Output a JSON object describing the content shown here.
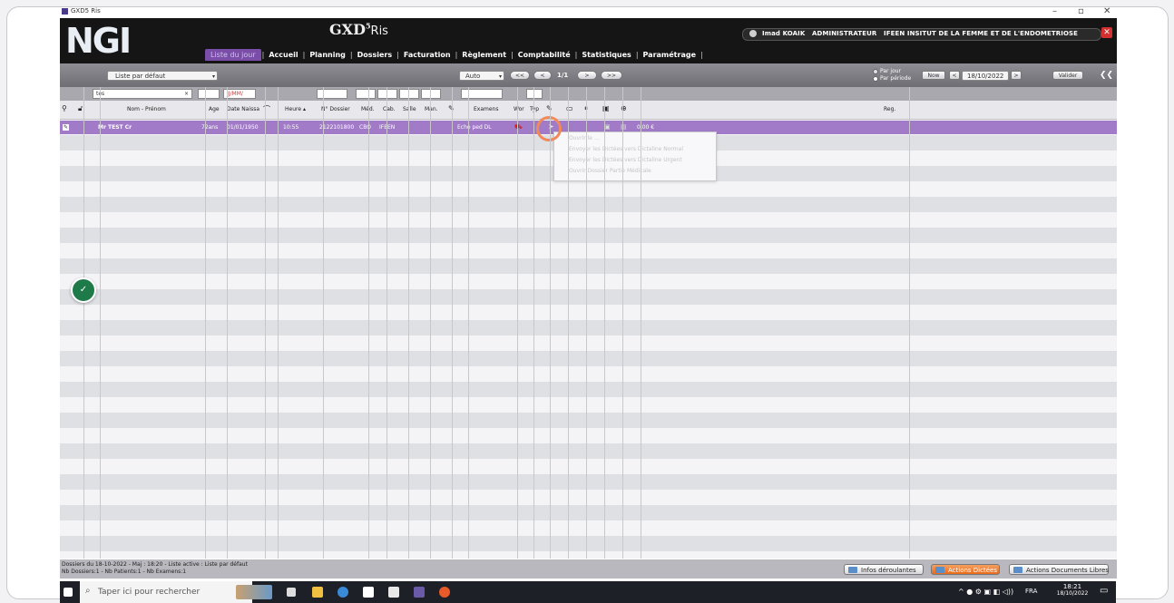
{
  "window": {
    "title": "GXD5 Ris",
    "min": "–",
    "max": "▫",
    "close": "✕"
  },
  "header": {
    "logo": "NGI",
    "brand": "GXD",
    "brand_sup": "5",
    "brand_suffix": "Ris",
    "user": "Imad KOAIK",
    "role": "ADMINISTRATEUR",
    "institution": "IFEEN INSITUT DE LA FEMME ET DE L'ENDOMETRIOSE",
    "close_btn": "✕"
  },
  "menu": [
    "Liste du jour",
    "Accueil",
    "Planning",
    "Dossiers",
    "Facturation",
    "Règlement",
    "Comptabilité",
    "Statistiques",
    "Paramétrage"
  ],
  "toolbar": {
    "list_select": "Liste par défaut",
    "mode_select": "Auto",
    "nav_first": "<<",
    "nav_prev": "<",
    "page": "1/1",
    "nav_next": ">",
    "nav_last": ">>",
    "radio_day": "Par jour",
    "radio_period": "Par période",
    "now": "Now",
    "date": "18/10/2022",
    "validate": "Valider",
    "collapse": "❮❮"
  },
  "filters": {
    "name": "tes",
    "date_placeholder": "JJ/MM/"
  },
  "columns": [
    "Nom - Prénom",
    "Age",
    "Date Naissa",
    "Heure",
    "N° Dossier",
    "Méd.",
    "Cab.",
    "Salle",
    "Man.",
    "Examens",
    "Wor",
    "Typ",
    "Reg."
  ],
  "row": {
    "name": "Mr TEST Cr",
    "age": "72ans",
    "dob": "01/01/1950",
    "time": "10:55",
    "file": "2122101800",
    "doc": "CBO",
    "cab": "IFEEN",
    "exam": "Echo ped DL",
    "amount": "0,00 €"
  },
  "dropdown": {
    "items": [
      "Ouvrir le …",
      "Envoyer les Dictées vers Dictaline Normal",
      "Envoyer les Dictées vers Dictaline Urgent",
      "Ouvrir Dossier Partie Médicale"
    ]
  },
  "status": {
    "line1": "Dossiers du 18-10-2022  - Maj : 18:20 - Liste active : Liste par défaut",
    "line2": "Nb Dossiers:1 - Nb Patients:1 - Nb Examens:1",
    "btn_info": "Infos déroulantes",
    "btn_dictees": "Actions Dictées",
    "btn_docs": "Actions Documents Libres"
  },
  "taskbar": {
    "search": "Taper ici pour rechercher",
    "lang": "FRA",
    "time": "18:21",
    "date": "18/10/2022"
  }
}
